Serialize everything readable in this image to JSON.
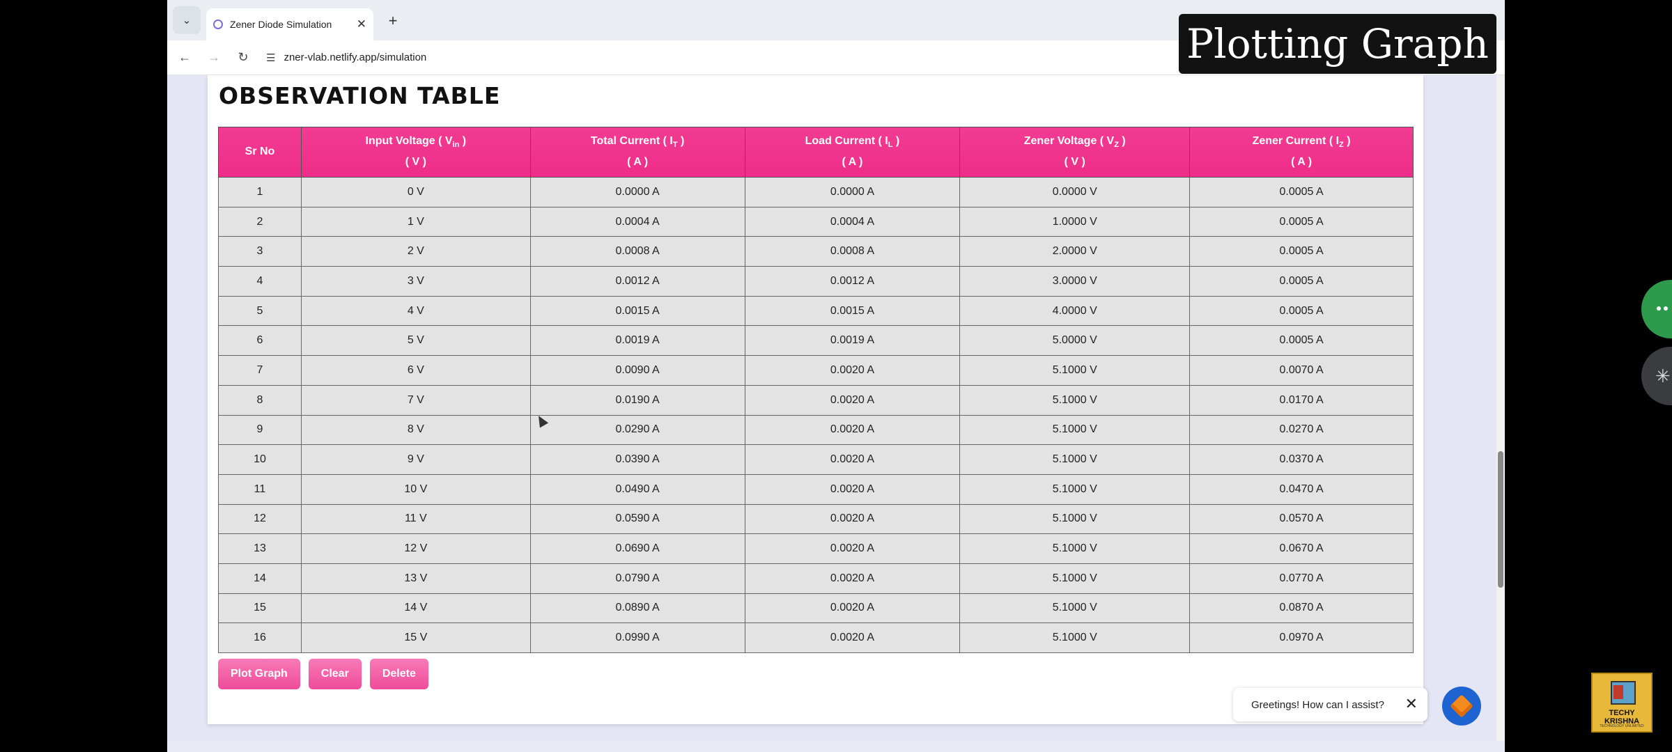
{
  "browser": {
    "tab_title": "Zener Diode Simulation",
    "url": "zner-vlab.netlify.app/simulation"
  },
  "overlay_title": "Plotting Graph",
  "page": {
    "title": "OBSERVATION TABLE",
    "accent_color": "#f0328f"
  },
  "table": {
    "headers": [
      {
        "label": "Sr No",
        "unit": ""
      },
      {
        "label": "Input Voltage ( V",
        "sub": "in",
        "tail": " )",
        "unit": "( V )"
      },
      {
        "label": "Total Current ( I",
        "sub": "T",
        "tail": " )",
        "unit": "( A )"
      },
      {
        "label": "Load Current ( I",
        "sub": "L",
        "tail": " )",
        "unit": "( A )"
      },
      {
        "label": "Zener Voltage ( V",
        "sub": "Z",
        "tail": " )",
        "unit": "( V )"
      },
      {
        "label": "Zener Current ( I",
        "sub": "Z",
        "tail": " )",
        "unit": "( A )"
      }
    ],
    "rows": [
      [
        "1",
        "0 V",
        "0.0000 A",
        "0.0000 A",
        "0.0000 V",
        "0.0005 A"
      ],
      [
        "2",
        "1 V",
        "0.0004 A",
        "0.0004 A",
        "1.0000 V",
        "0.0005 A"
      ],
      [
        "3",
        "2 V",
        "0.0008 A",
        "0.0008 A",
        "2.0000 V",
        "0.0005 A"
      ],
      [
        "4",
        "3 V",
        "0.0012 A",
        "0.0012 A",
        "3.0000 V",
        "0.0005 A"
      ],
      [
        "5",
        "4 V",
        "0.0015 A",
        "0.0015 A",
        "4.0000 V",
        "0.0005 A"
      ],
      [
        "6",
        "5 V",
        "0.0019 A",
        "0.0019 A",
        "5.0000 V",
        "0.0005 A"
      ],
      [
        "7",
        "6 V",
        "0.0090 A",
        "0.0020 A",
        "5.1000 V",
        "0.0070 A"
      ],
      [
        "8",
        "7 V",
        "0.0190 A",
        "0.0020 A",
        "5.1000 V",
        "0.0170 A"
      ],
      [
        "9",
        "8 V",
        "0.0290 A",
        "0.0020 A",
        "5.1000 V",
        "0.0270 A"
      ],
      [
        "10",
        "9 V",
        "0.0390 A",
        "0.0020 A",
        "5.1000 V",
        "0.0370 A"
      ],
      [
        "11",
        "10 V",
        "0.0490 A",
        "0.0020 A",
        "5.1000 V",
        "0.0470 A"
      ],
      [
        "12",
        "11 V",
        "0.0590 A",
        "0.0020 A",
        "5.1000 V",
        "0.0570 A"
      ],
      [
        "13",
        "12 V",
        "0.0690 A",
        "0.0020 A",
        "5.1000 V",
        "0.0670 A"
      ],
      [
        "14",
        "13 V",
        "0.0790 A",
        "0.0020 A",
        "5.1000 V",
        "0.0770 A"
      ],
      [
        "15",
        "14 V",
        "0.0890 A",
        "0.0020 A",
        "5.1000 V",
        "0.0870 A"
      ],
      [
        "16",
        "15 V",
        "0.0990 A",
        "0.0020 A",
        "5.1000 V",
        "0.0970 A"
      ]
    ]
  },
  "buttons": {
    "plot": "Plot Graph",
    "clear": "Clear",
    "delete": "Delete"
  },
  "chat": {
    "greeting": "Greetings! How can I assist?"
  },
  "logo": {
    "name": "TECHY KRISHNA",
    "tagline": "TECHNOLOGY UNLIMITED"
  }
}
